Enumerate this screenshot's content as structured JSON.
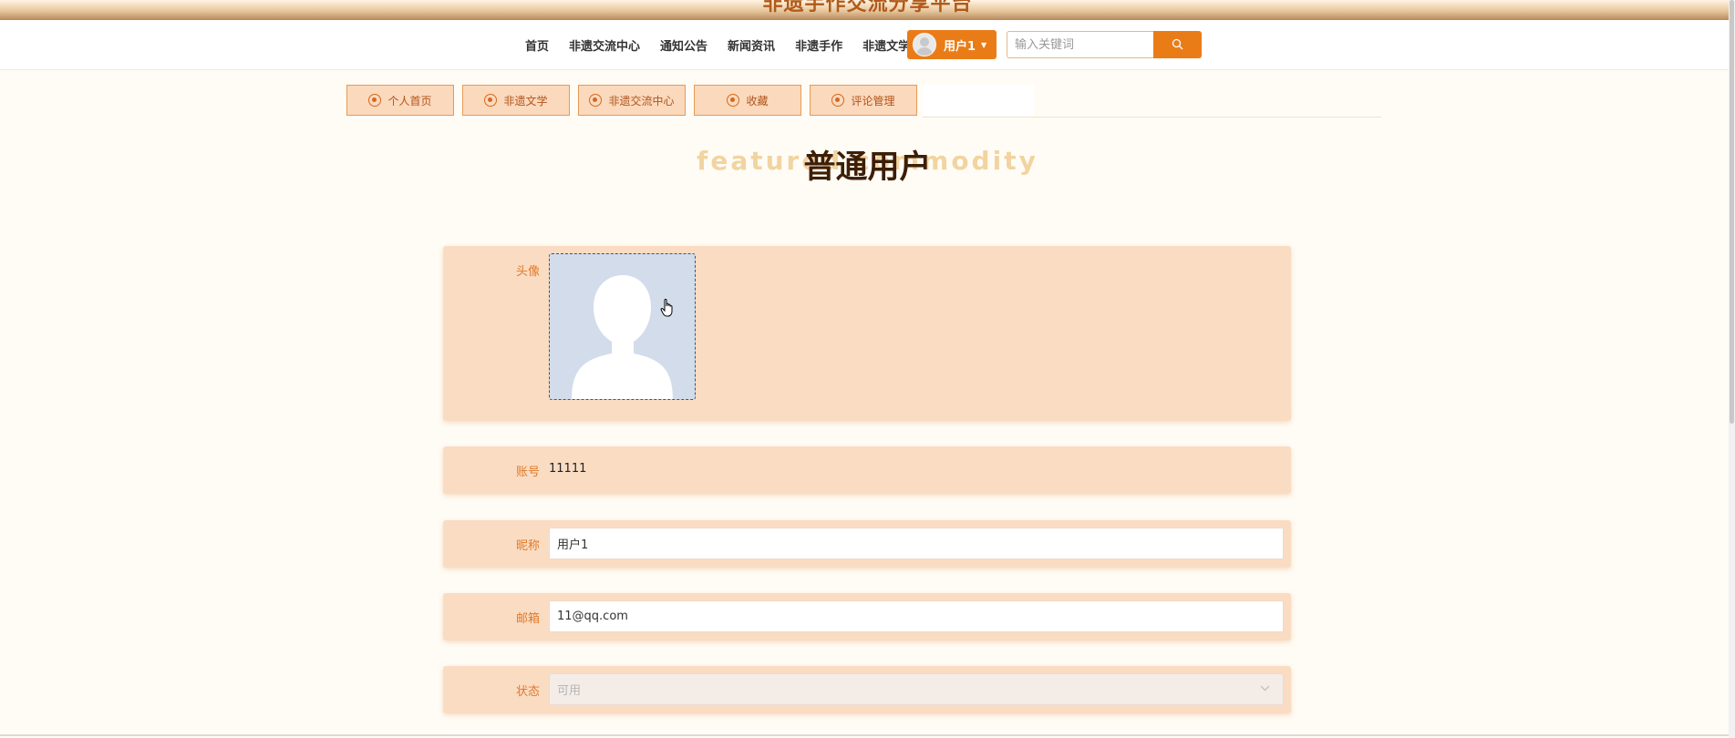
{
  "site": {
    "title": "非遗手作交流分享平台"
  },
  "nav": {
    "items": [
      "首页",
      "非遗交流中心",
      "通知公告",
      "新闻资讯",
      "非遗手作",
      "非遗文学"
    ],
    "user_label": "用户1",
    "search_placeholder": "输入关键词"
  },
  "tabs": [
    "个人首页",
    "非遗文学",
    "非遗交流中心",
    "收藏",
    "评论管理"
  ],
  "heading": {
    "background_text": "featured commodity",
    "title": "普通用户"
  },
  "form": {
    "avatar_label": "头像",
    "account_label": "账号",
    "account_value": "11111",
    "nickname_label": "昵称",
    "nickname_value": "用户1",
    "email_label": "邮箱",
    "email_value": "11@qq.com",
    "status_label": "状态",
    "status_value": "可用"
  },
  "colors": {
    "accent": "#ea7c18",
    "page_background": "#fffcf5",
    "row_background": "#fadcc3",
    "label": "#e07a2a",
    "heading": "#3d1e06"
  }
}
